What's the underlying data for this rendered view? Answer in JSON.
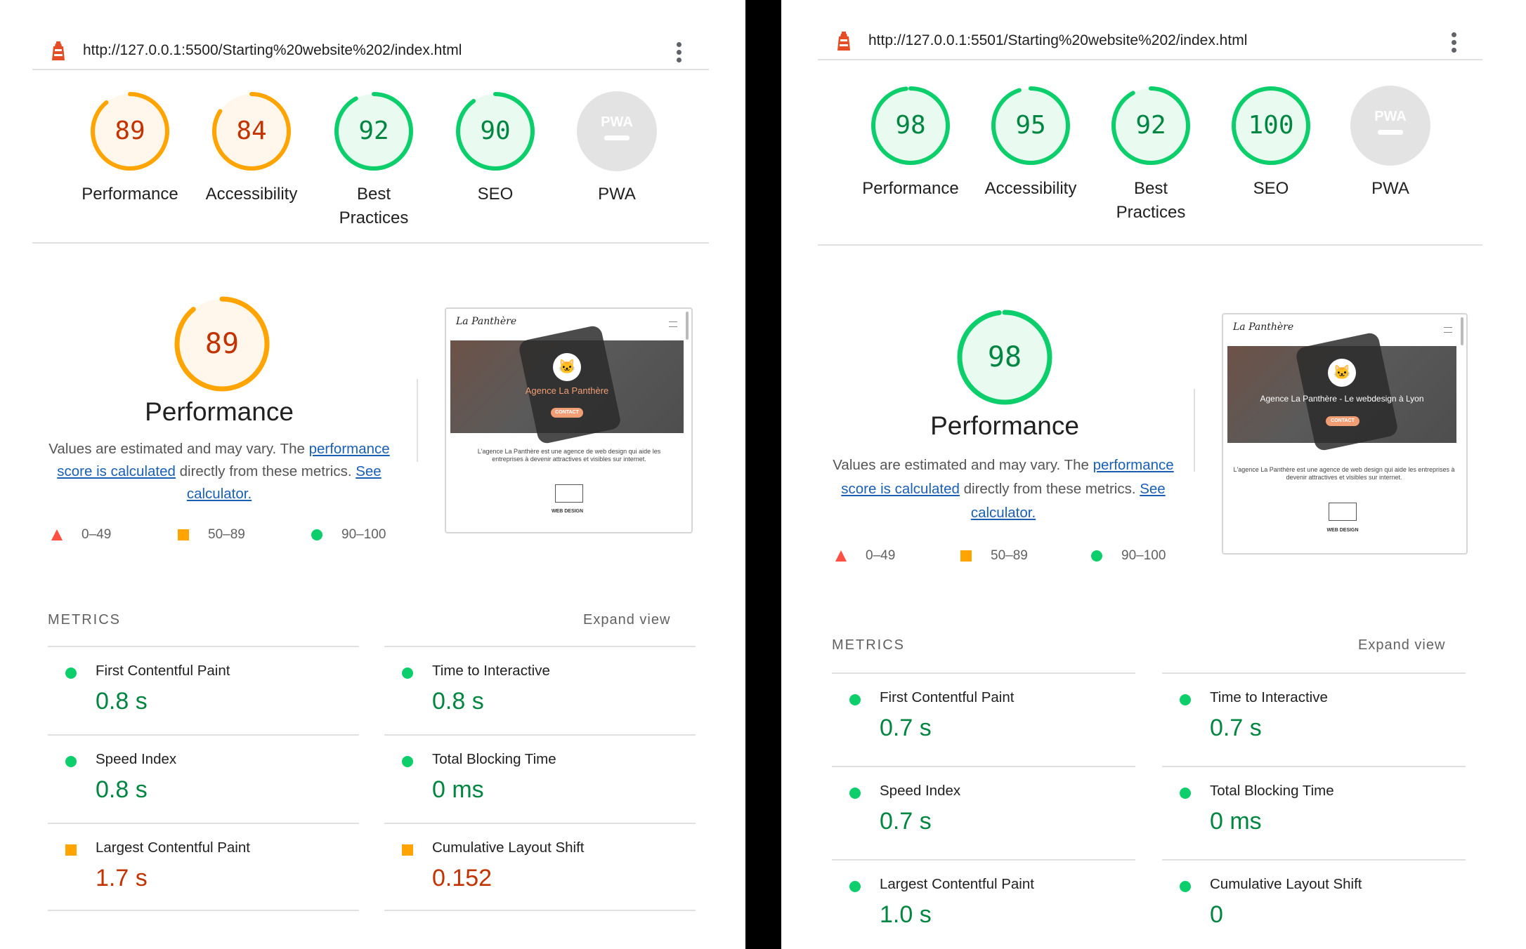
{
  "panels": [
    {
      "url": "http://127.0.0.1:5500/Starting%20website%202/index.html",
      "gauges": [
        {
          "score": "89",
          "label": "Performance",
          "status": "average",
          "fraction": 0.89
        },
        {
          "score": "84",
          "label": "Accessibility",
          "status": "average",
          "fraction": 0.84
        },
        {
          "score": "92",
          "label": "Best Practices",
          "label_line1": "Best",
          "label_line2": "Practices",
          "status": "pass",
          "fraction": 0.92
        },
        {
          "score": "90",
          "label": "SEO",
          "status": "pass",
          "fraction": 0.9
        },
        {
          "score": "PWA",
          "label": "PWA",
          "status": "na",
          "fraction": 0
        }
      ],
      "performance": {
        "score": "89",
        "status": "average",
        "title": "Performance",
        "desc_before": "Values are estimated and may vary. The ",
        "desc_link1": "performance score is calculated",
        "desc_middle": " directly from these metrics. ",
        "desc_link2": "See calculator."
      },
      "legend": [
        "0–49",
        "50–89",
        "90–100"
      ],
      "thumbnail": {
        "brand": "La Panthère",
        "hero_text": "Agence La Panthère",
        "button": "CONTACT",
        "body": "L'agence La Panthère est une agence de web design qui aide les entreprises à devenir attractives et visibles sur internet.",
        "section": "WEB DESIGN"
      },
      "metrics_heading": "METRICS",
      "expand_label": "Expand view",
      "metrics": [
        {
          "title": "First Contentful Paint",
          "value": "0.8 s",
          "status": "pass"
        },
        {
          "title": "Time to Interactive",
          "value": "0.8 s",
          "status": "pass"
        },
        {
          "title": "Speed Index",
          "value": "0.8 s",
          "status": "pass"
        },
        {
          "title": "Total Blocking Time",
          "value": "0 ms",
          "status": "pass"
        },
        {
          "title": "Largest Contentful Paint",
          "value": "1.7 s",
          "status": "average"
        },
        {
          "title": "Cumulative Layout Shift",
          "value": "0.152",
          "status": "average"
        }
      ]
    },
    {
      "url": "http://127.0.0.1:5501/Starting%20website%202/index.html",
      "gauges": [
        {
          "score": "98",
          "label": "Performance",
          "status": "pass",
          "fraction": 0.98
        },
        {
          "score": "95",
          "label": "Accessibility",
          "status": "pass",
          "fraction": 0.95
        },
        {
          "score": "92",
          "label": "Best Practices",
          "label_line1": "Best",
          "label_line2": "Practices",
          "status": "pass",
          "fraction": 0.92
        },
        {
          "score": "100",
          "label": "SEO",
          "status": "pass",
          "fraction": 1.0
        },
        {
          "score": "PWA",
          "label": "PWA",
          "status": "na",
          "fraction": 0
        }
      ],
      "performance": {
        "score": "98",
        "status": "pass",
        "title": "Performance",
        "desc_before": "Values are estimated and may vary. The ",
        "desc_link1": "performance score is calculated",
        "desc_middle": " directly from these metrics. ",
        "desc_link2": "See calculator."
      },
      "legend": [
        "0–49",
        "50–89",
        "90–100"
      ],
      "thumbnail": {
        "brand": "La Panthère",
        "hero_text": "Agence La Panthère - Le webdesign à Lyon",
        "button": "CONTACT",
        "body": "L'agence La Panthère est une agence de web design qui aide les entreprises à devenir attractives et visibles sur internet.",
        "section": "WEB DESIGN"
      },
      "metrics_heading": "METRICS",
      "expand_label": "Expand view",
      "metrics": [
        {
          "title": "First Contentful Paint",
          "value": "0.7 s",
          "status": "pass"
        },
        {
          "title": "Time to Interactive",
          "value": "0.7 s",
          "status": "pass"
        },
        {
          "title": "Speed Index",
          "value": "0.7 s",
          "status": "pass"
        },
        {
          "title": "Total Blocking Time",
          "value": "0 ms",
          "status": "pass"
        },
        {
          "title": "Largest Contentful Paint",
          "value": "1.0 s",
          "status": "pass"
        },
        {
          "title": "Cumulative Layout Shift",
          "value": "0",
          "status": "pass"
        }
      ]
    }
  ],
  "colors": {
    "pass": "#0cce6b",
    "pass_text": "#018642",
    "pass_fill": "#e9faf1",
    "average": "#ffa400",
    "average_text": "#c33300",
    "average_fill": "#fff7ec",
    "fail": "#ff4e42",
    "na": "#9e9e9e",
    "na_fill": "#e3e3e3",
    "link": "#1a5fb4"
  }
}
